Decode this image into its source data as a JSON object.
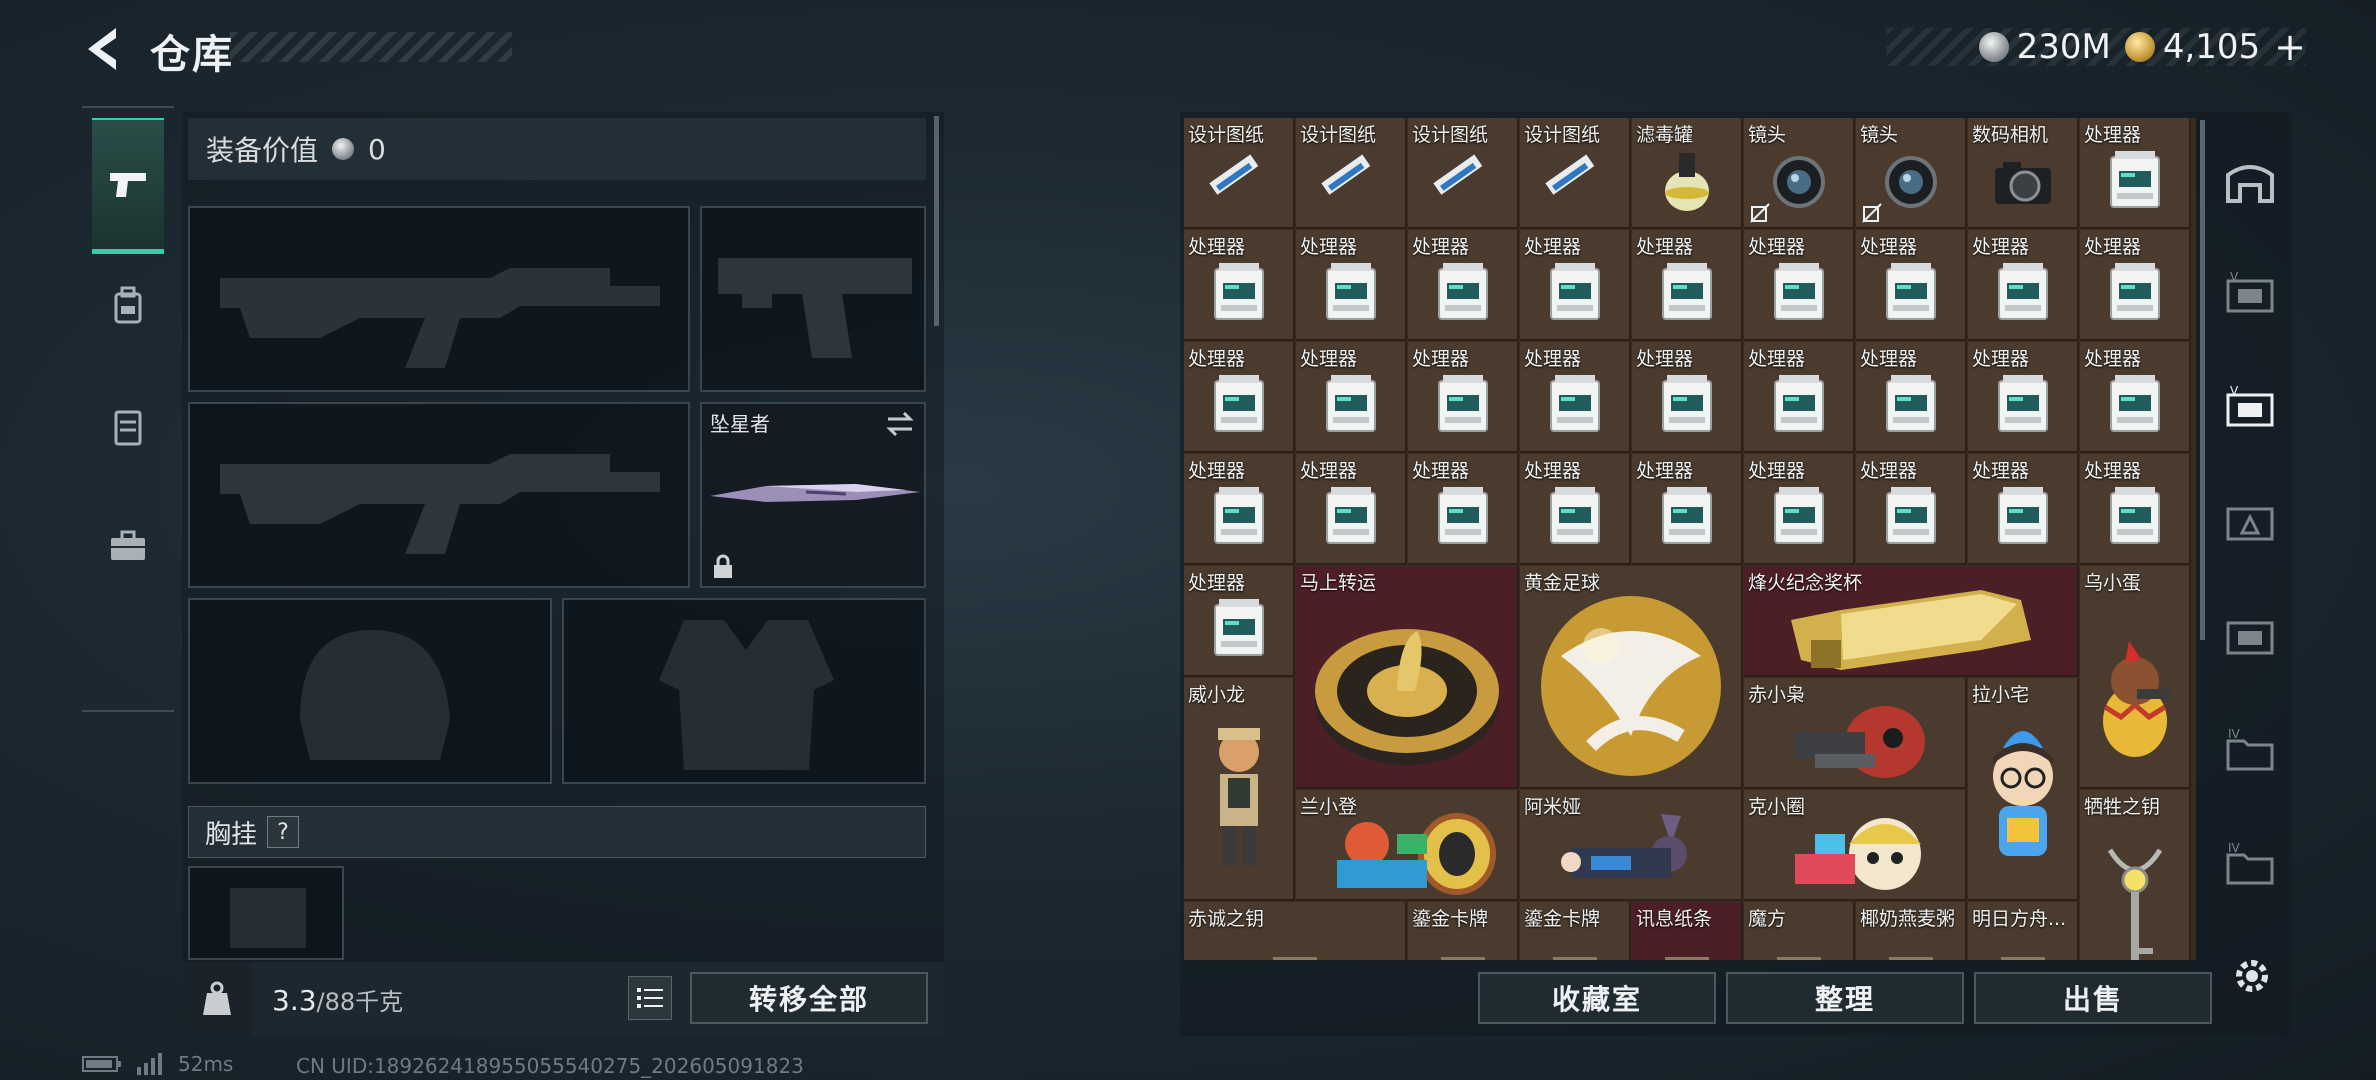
{
  "header": {
    "title": "仓库"
  },
  "currency": {
    "silver": "230M",
    "gold": "4,105",
    "plus": "+"
  },
  "side_tabs": [
    "gun-icon",
    "backpack-icon",
    "rig-icon",
    "toolbox-icon"
  ],
  "equipment": {
    "value_label": "装备价值",
    "value": "0",
    "melee_name": "坠星者",
    "chest_label": "胸挂",
    "help": "?"
  },
  "bottom_left": {
    "weight_current": "3.3",
    "weight_capacity": "/88千克",
    "transfer_all": "转移全部"
  },
  "grid": {
    "items": [
      {
        "name": "设计图纸",
        "icon": "blueprint"
      },
      {
        "name": "设计图纸",
        "icon": "blueprint"
      },
      {
        "name": "设计图纸",
        "icon": "blueprint"
      },
      {
        "name": "设计图纸",
        "icon": "blueprint"
      },
      {
        "name": "滤毒罐",
        "icon": "filter"
      },
      {
        "name": "镜头",
        "icon": "lens"
      },
      {
        "name": "镜头",
        "icon": "lens"
      },
      {
        "name": "数码相机",
        "icon": "camera"
      },
      {
        "name": "处理器",
        "icon": "processor"
      }
    ],
    "processor_label": "处理器",
    "big_items": [
      {
        "name": "马上转运",
        "icon": "fortune-plate"
      },
      {
        "name": "黄金足球",
        "icon": "gold-ball"
      },
      {
        "name": "烽火纪念奖杯",
        "icon": "trophy"
      },
      {
        "name": "乌小蛋",
        "icon": "egg-figure"
      },
      {
        "name": "威小龙",
        "icon": "soldier-figure"
      },
      {
        "name": "赤小枭",
        "icon": "owl-figure"
      },
      {
        "name": "拉小宅",
        "icon": "nerd-figure"
      },
      {
        "name": "兰小登",
        "icon": "lan-figure"
      },
      {
        "name": "阿米娅",
        "icon": "amiya-figure"
      },
      {
        "name": "克小圈",
        "icon": "ke-figure"
      },
      {
        "name": "牺牲之钥",
        "icon": "key"
      }
    ],
    "bottom_row": [
      "赤诚之钥",
      "鎏金卡牌",
      "鎏金卡牌",
      "讯息纸条",
      "魔方",
      "椰奶燕麦粥",
      "明日方舟..."
    ]
  },
  "right_buttons": {
    "vault": "收藏室",
    "sort": "整理",
    "sell": "出售"
  },
  "status": {
    "ping": "52ms",
    "uid": "CN UID:189262418955055540275_202605091823"
  },
  "colors": {
    "accent": "#2fd1a6",
    "cell_brown": "#4a3b2e",
    "cell_red": "#4c1f27"
  }
}
